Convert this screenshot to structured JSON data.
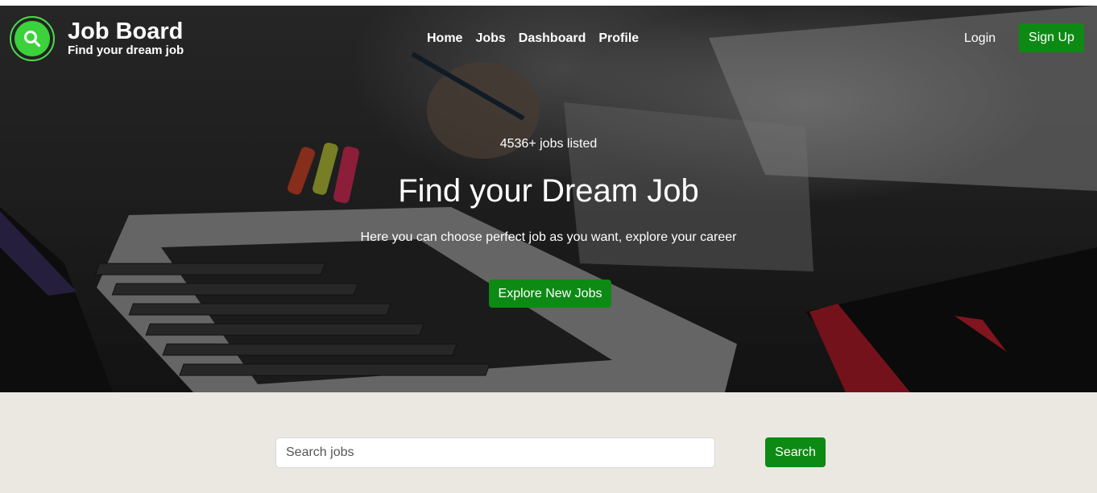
{
  "brand": {
    "title": "Job Board",
    "tagline": "Find your dream job",
    "icon": "search-icon"
  },
  "nav": {
    "items": [
      {
        "label": "Home"
      },
      {
        "label": "Jobs"
      },
      {
        "label": "Dashboard"
      },
      {
        "label": "Profile"
      }
    ]
  },
  "auth": {
    "login_label": "Login",
    "signup_label": "Sign Up"
  },
  "hero": {
    "count_text": "4536+ jobs listed",
    "headline": "Find your Dream Job",
    "subline": "Here you can choose perfect job as you want, explore your career",
    "cta_label": "Explore New Jobs"
  },
  "search": {
    "placeholder": "Search jobs",
    "value": "",
    "button_label": "Search"
  },
  "colors": {
    "accent_green": "#0d8a14",
    "logo_green": "#3cd23c",
    "search_bg": "#ebe8e2"
  }
}
